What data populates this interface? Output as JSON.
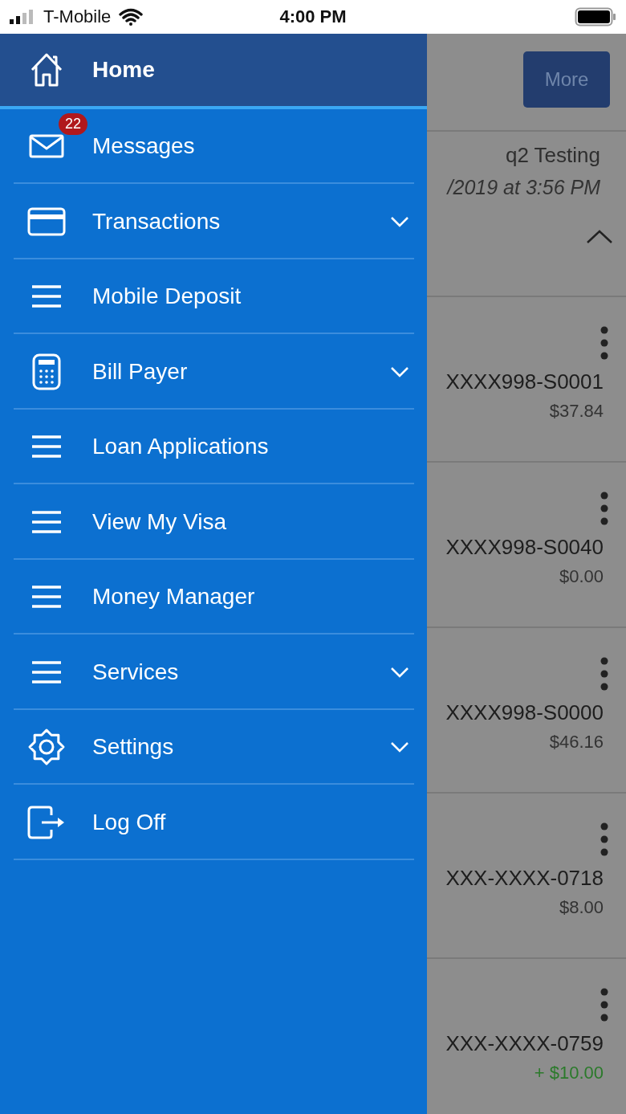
{
  "status_bar": {
    "carrier": "T-Mobile",
    "time": "4:00 PM"
  },
  "menu": [
    {
      "label": "Home",
      "kind": "home",
      "selected": true,
      "expandable": false
    },
    {
      "label": "Messages",
      "kind": "mail",
      "selected": false,
      "expandable": false,
      "badge": "22"
    },
    {
      "label": "Transactions",
      "kind": "card",
      "selected": false,
      "expandable": true
    },
    {
      "label": "Mobile Deposit",
      "kind": "lines",
      "selected": false,
      "expandable": false
    },
    {
      "label": "Bill Payer",
      "kind": "calculator",
      "selected": false,
      "expandable": true
    },
    {
      "label": "Loan Applications",
      "kind": "lines",
      "selected": false,
      "expandable": false
    },
    {
      "label": "View My Visa",
      "kind": "lines",
      "selected": false,
      "expandable": false
    },
    {
      "label": "Money Manager",
      "kind": "lines",
      "selected": false,
      "expandable": false
    },
    {
      "label": "Services",
      "kind": "lines",
      "selected": false,
      "expandable": true
    },
    {
      "label": "Settings",
      "kind": "gear",
      "selected": false,
      "expandable": true
    },
    {
      "label": "Log Off",
      "kind": "logout",
      "selected": false,
      "expandable": false
    }
  ],
  "background": {
    "more_button": "More",
    "user": "q2 Testing",
    "last_login": "/2019 at 3:56 PM",
    "accounts": [
      {
        "number": "XXXX998-S0001",
        "amount": "$37.84",
        "kind": "balance"
      },
      {
        "number": "XXXX998-S0040",
        "amount": "$0.00",
        "kind": "balance"
      },
      {
        "number": "XXXX998-S0000",
        "amount": "$46.16",
        "kind": "balance"
      },
      {
        "number": "XXX-XXXX-0718",
        "amount": "$8.00",
        "kind": "balance"
      },
      {
        "number": "XXX-XXXX-0759",
        "amount": "+ $10.00",
        "kind": "credit"
      }
    ]
  }
}
